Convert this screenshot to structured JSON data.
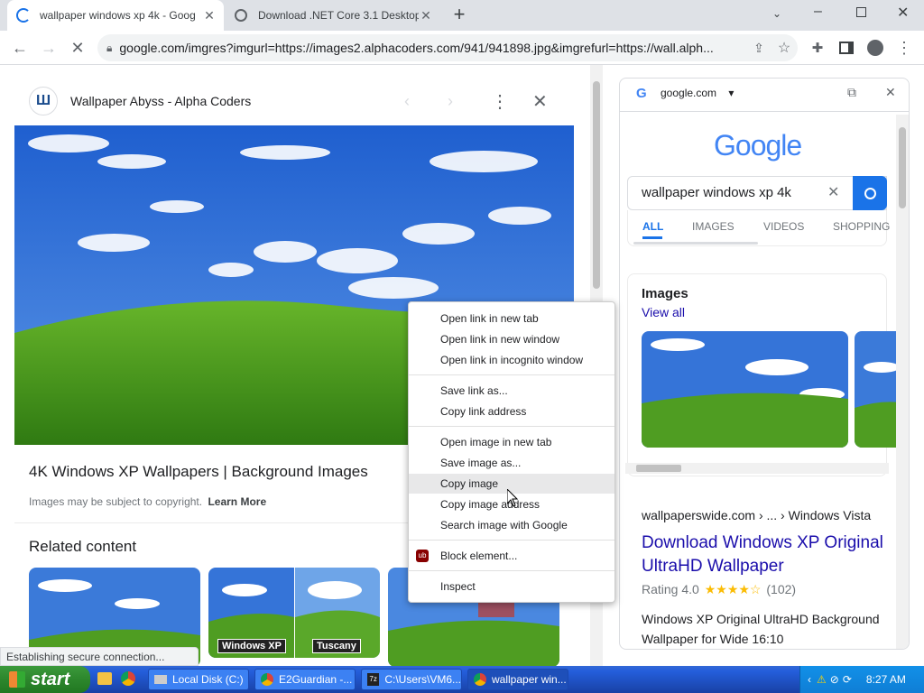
{
  "tabs": [
    {
      "title": "wallpaper windows xp 4k - Goog",
      "active": true
    },
    {
      "title": "Download .NET Core 3.1 Desktop",
      "active": false
    }
  ],
  "omnibox": {
    "url": "google.com/imgres?imgurl=https://images2.alphacoders.com/941/941898.jpg&imgrefurl=https://wall.alph..."
  },
  "viewer": {
    "source_name": "Wallpaper Abyss - Alpha Coders",
    "title": "4K Windows XP Wallpapers | Background Images",
    "copyright_text": "Images may be subject to copyright.",
    "learn_more": "Learn More",
    "related_heading": "Related content",
    "related_labels": [
      "Windows XP",
      "Tuscany"
    ]
  },
  "status_bar": "Establishing secure connection...",
  "context_menu": {
    "items": [
      "Open link in new tab",
      "Open link in new window",
      "Open link in incognito window",
      "Save link as...",
      "Copy link address",
      "Open image in new tab",
      "Save image as...",
      "Copy image",
      "Copy image address",
      "Search image with Google",
      "Block element...",
      "Inspect"
    ],
    "hovered": "Copy image"
  },
  "side_panel": {
    "site": "google.com",
    "logo": "Google",
    "search_value": "wallpaper windows xp 4k",
    "tabs": [
      "ALL",
      "IMAGES",
      "VIDEOS",
      "SHOPPING"
    ],
    "active_tab": "ALL",
    "images_heading": "Images",
    "view_all": "View all",
    "result": {
      "breadcrumb": "wallpaperswide.com › ... › Windows Vista",
      "title": "Download Windows XP Original UltraHD Wallpaper",
      "rating_label": "Rating 4.0",
      "stars": "★★★★☆",
      "rating": 4.0,
      "reviews": "(102)",
      "snippet": "Windows XP Original UltraHD Background Wallpaper for Wide 16:10"
    }
  },
  "taskbar": {
    "start": "start",
    "buttons": [
      "Local Disk (C:)",
      "E2Guardian -...",
      "C:\\Users\\VM6...",
      "wallpaper win..."
    ],
    "active_button": "wallpaper win...",
    "clock": "8:27 AM"
  },
  "colors": {
    "accent": "#1a73e8",
    "sky": "#2f6fd6",
    "grass": "#4a9a1e",
    "taskbar": "#245edb",
    "start": "#2f8a2f"
  }
}
